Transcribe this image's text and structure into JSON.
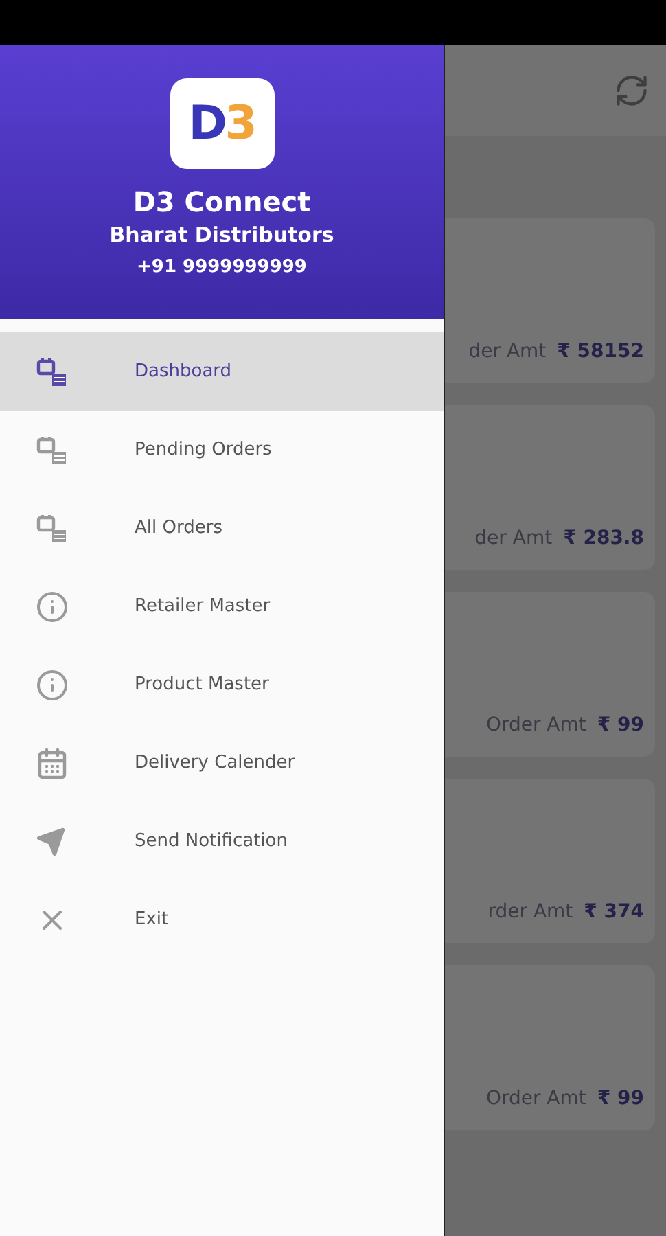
{
  "drawer": {
    "logo_letters": [
      {
        "text": "D",
        "color": "#3a36b8"
      },
      {
        "text": "3",
        "color": "#f2a43a"
      }
    ],
    "app_name": "D3 Connect",
    "company": "Bharat Distributors",
    "phone": "+91 9999999999",
    "items": [
      {
        "label": "Dashboard",
        "kind": "orders",
        "selected": true
      },
      {
        "label": "Pending Orders",
        "kind": "orders",
        "selected": false
      },
      {
        "label": "All Orders",
        "kind": "orders",
        "selected": false
      },
      {
        "label": "Retailer Master",
        "kind": "info",
        "selected": false
      },
      {
        "label": "Product Master",
        "kind": "info",
        "selected": false
      },
      {
        "label": "Delivery Calender",
        "kind": "calendar",
        "selected": false
      },
      {
        "label": "Send Notification",
        "kind": "send",
        "selected": false
      },
      {
        "label": "Exit",
        "kind": "close",
        "selected": false
      }
    ]
  },
  "orders": [
    {
      "label": "der Amt",
      "amount": "₹ 58152"
    },
    {
      "label": "der Amt",
      "amount": "₹ 283.8"
    },
    {
      "label": "Order Amt",
      "amount": "₹ 99"
    },
    {
      "label": "rder Amt",
      "amount": "₹ 374"
    },
    {
      "label": "Order Amt",
      "amount": "₹ 99"
    }
  ]
}
